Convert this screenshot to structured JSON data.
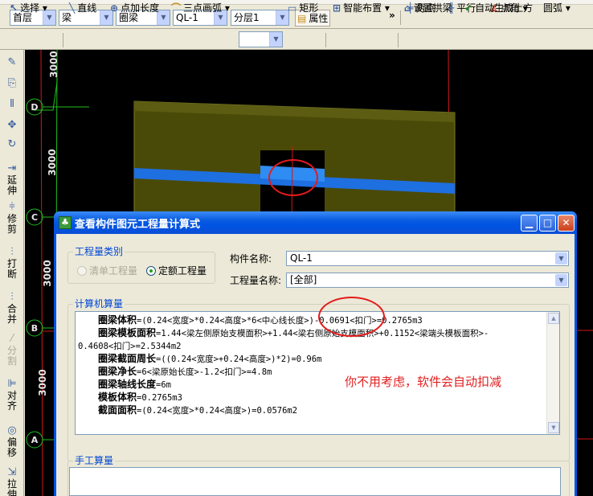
{
  "toolbar1": {
    "floor_value": "首层",
    "component_type_value": "梁",
    "component_subtype_value": "圈梁",
    "component_name_value": "QL-1",
    "layer_value": "分层1",
    "properties_label": "属性",
    "more_glyph": "»",
    "two_point_label": "两点",
    "parallel_label": "平行",
    "point_angle_label": "点角",
    "arc_label": "圆弧"
  },
  "toolbar2": {
    "select_label": "选择",
    "line_label": "直线",
    "point_add_length_label": "点加长度",
    "three_point_arc_label": "三点画弧",
    "rectangle_label": "矩形",
    "smart_layout_label": "智能布置",
    "set_arch_beam_label": "设置拱梁",
    "auto_earthwork_label": "自动生成土方"
  },
  "left_tools": [
    {
      "label": "",
      "icon": "brush-icon"
    },
    {
      "label": "",
      "icon": "copy-icon"
    },
    {
      "label": "",
      "icon": "mirror-icon"
    },
    {
      "label": "",
      "icon": "move-icon"
    },
    {
      "label": "",
      "icon": "rotate-icon"
    },
    {
      "label": "延伸",
      "icon": "extend-icon"
    },
    {
      "label": "修剪",
      "icon": "trim-icon"
    },
    {
      "label": "打断",
      "icon": "break-icon"
    },
    {
      "label": "合并",
      "icon": "merge-icon"
    },
    {
      "label": "分割",
      "icon": "split-icon"
    },
    {
      "label": "对齐",
      "icon": "align-icon"
    },
    {
      "label": "偏移",
      "icon": "offset-icon"
    },
    {
      "label": "拉伸",
      "icon": "stretch-icon"
    }
  ],
  "canvas": {
    "axis_labels": [
      "D",
      "C",
      "B",
      "A"
    ],
    "dimensions": [
      "3000",
      "3000",
      "3000",
      "3000"
    ],
    "annotation": "你不用考虑，软件会自动扣减"
  },
  "dialog": {
    "title": "查看构件图元工程量计算式",
    "quantity_category_label": "工程量类别",
    "radio_list_quantity": "清单工程量",
    "radio_quota_quantity": "定额工程量",
    "component_name_label": "构件名称:",
    "component_name_value": "QL-1",
    "quantity_name_label": "工程量名称:",
    "quantity_name_value": "[全部]",
    "computer_calc_label": "计算机算量",
    "calc_lines": [
      {
        "name": "圈梁体积",
        "expr": "=(0.24<宽度>*0.24<高度>*6<中心线长度>)-0.0691<扣门>=0.2765m3"
      },
      {
        "name": "圈梁模板面积",
        "expr": "=1.44<梁左侧原始支模面积>+1.44<梁右侧原始支模面积>+0.1152<梁端头模板面积>-"
      },
      {
        "name": "",
        "expr": "0.4608<扣门>=2.5344m2"
      },
      {
        "name": "圈梁截面周长",
        "expr": "=((0.24<宽度>+0.24<高度>)*2)=0.96m"
      },
      {
        "name": "圈梁净长",
        "expr": "=6<梁原始长度>-1.2<扣门>=4.8m"
      },
      {
        "name": "圈梁轴线长度",
        "expr": "=6m"
      },
      {
        "name": "模板体积",
        "expr": "=0.2765m3"
      },
      {
        "name": "截面面积",
        "expr": "=(0.24<宽度>*0.24<高度>)=0.0576m2"
      }
    ],
    "manual_calc_label": "手工算量"
  },
  "colors": {
    "slab": "#4a4a08",
    "beam": "#1e6fe0",
    "axis_green": "#1fc11f",
    "grid_red": "#d11818",
    "annotation_red": "#e02020",
    "xp_title_blue": "#0054e3"
  }
}
